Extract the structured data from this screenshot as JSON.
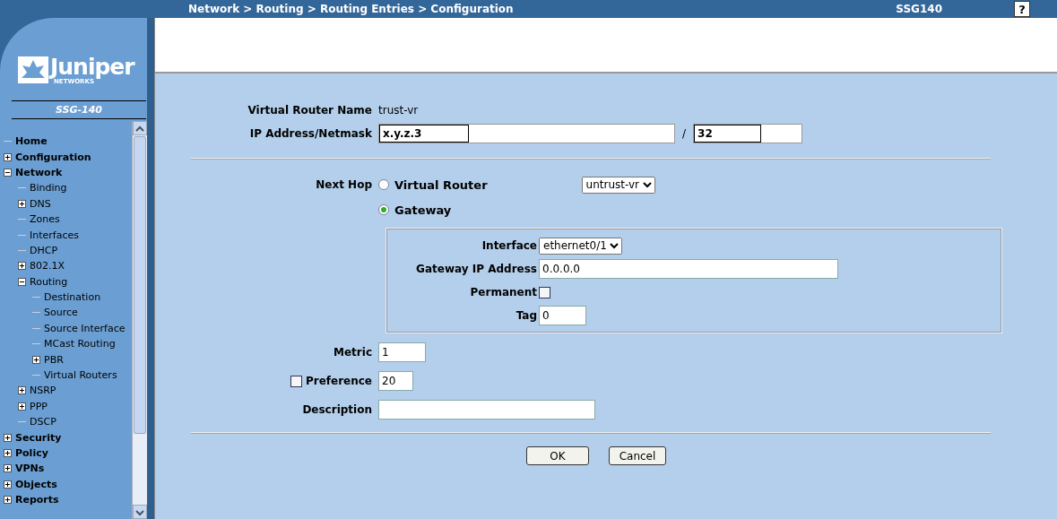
{
  "header": {
    "breadcrumb": "Network > Routing > Routing Entries > Configuration",
    "device": "SSG140",
    "help": "?"
  },
  "sidebar": {
    "logo": "Juniper",
    "logo_sub": "NETWORKS",
    "model": "SSG-140",
    "tree": [
      {
        "label": "Home"
      },
      {
        "label": "Configuration",
        "expanded": false
      },
      {
        "label": "Network",
        "expanded": true,
        "children": [
          {
            "label": "Binding"
          },
          {
            "label": "DNS",
            "expanded": false
          },
          {
            "label": "Zones"
          },
          {
            "label": "Interfaces"
          },
          {
            "label": "DHCP"
          },
          {
            "label": "802.1X",
            "expanded": false
          },
          {
            "label": "Routing",
            "expanded": true,
            "children": [
              {
                "label": "Destination"
              },
              {
                "label": "Source"
              },
              {
                "label": "Source Interface"
              },
              {
                "label": "MCast Routing"
              },
              {
                "label": "PBR",
                "expanded": false
              },
              {
                "label": "Virtual Routers"
              }
            ]
          },
          {
            "label": "NSRP",
            "expanded": false
          },
          {
            "label": "PPP",
            "expanded": false
          },
          {
            "label": "DSCP"
          }
        ]
      },
      {
        "label": "Security",
        "expanded": false
      },
      {
        "label": "Policy",
        "expanded": false
      },
      {
        "label": "VPNs",
        "expanded": false
      },
      {
        "label": "Objects",
        "expanded": false
      },
      {
        "label": "Reports",
        "expanded": false
      }
    ]
  },
  "form": {
    "virtual_router_name": {
      "label": "Virtual Router Name",
      "value": "trust-vr"
    },
    "ip": {
      "label": "IP Address/Netmask",
      "address": "x.y.z.3",
      "separator": "/",
      "netmask": "32"
    },
    "next_hop": {
      "label": "Next Hop",
      "options": [
        {
          "label": "Virtual Router",
          "selected": false
        },
        {
          "label": "Gateway",
          "selected": true
        }
      ],
      "router_select": "untrust-vr"
    },
    "gateway": {
      "interface": {
        "label": "Interface",
        "value": "ethernet0/1"
      },
      "ip": {
        "label": "Gateway IP Address",
        "value": "0.0.0.0"
      },
      "permanent": {
        "label": "Permanent",
        "checked": false
      },
      "tag": {
        "label": "Tag",
        "value": "0"
      }
    },
    "metric": {
      "label": "Metric",
      "value": "1"
    },
    "preference": {
      "label": "Preference",
      "checked": false,
      "value": "20"
    },
    "description": {
      "label": "Description"
    },
    "buttons": [
      "OK",
      "Cancel"
    ]
  }
}
